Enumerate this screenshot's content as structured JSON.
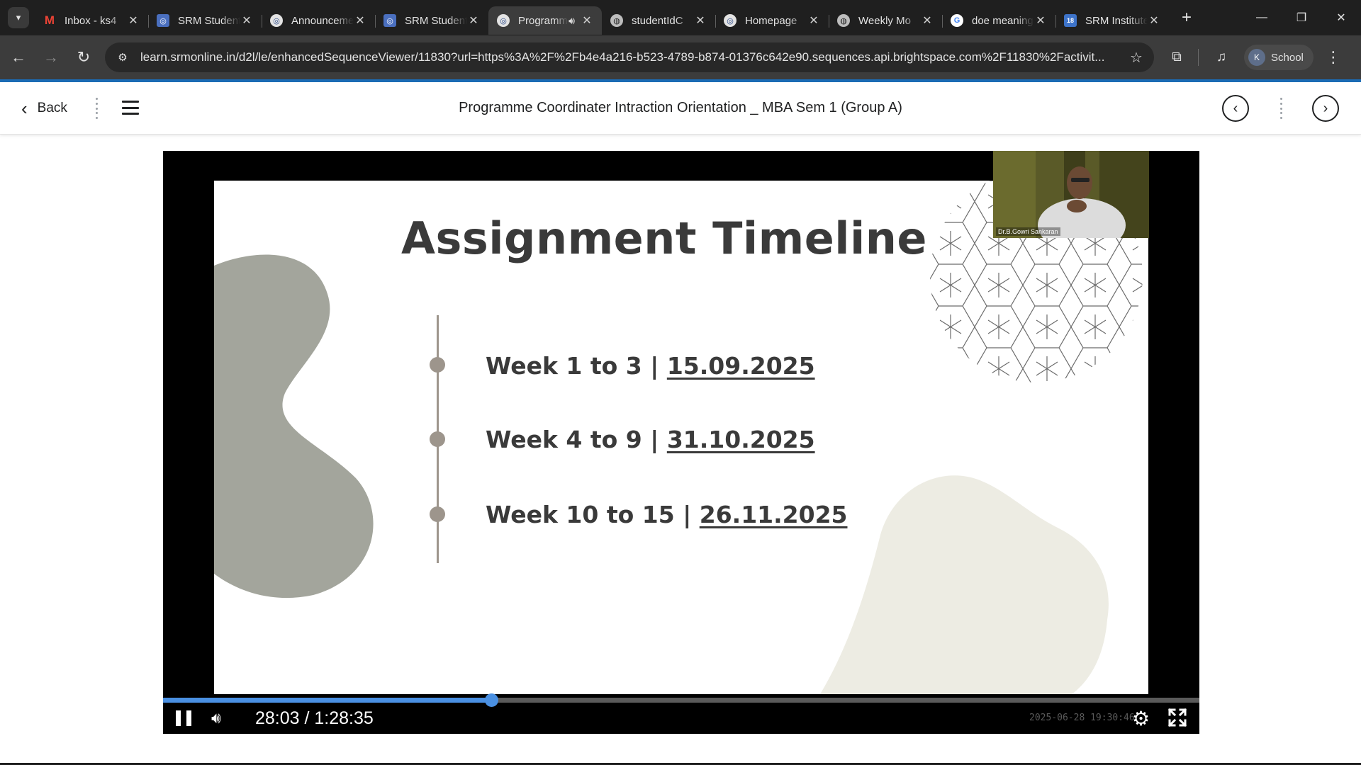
{
  "browser": {
    "tabs": [
      {
        "title": "Inbox - ks4",
        "favicon": "gmail-icon",
        "active": false
      },
      {
        "title": "SRM Student",
        "favicon": "d2l-icon",
        "active": false
      },
      {
        "title": "Announcements",
        "favicon": "d2l-circle-icon",
        "active": false
      },
      {
        "title": "SRM Student",
        "favicon": "d2l-icon",
        "active": false
      },
      {
        "title": "Programme",
        "favicon": "d2l-circle-icon",
        "active": true,
        "audio": true
      },
      {
        "title": "studentIdC",
        "favicon": "globe-icon",
        "active": false
      },
      {
        "title": "Homepage",
        "favicon": "d2l-circle-icon",
        "active": false
      },
      {
        "title": "Weekly Mo",
        "favicon": "globe-icon",
        "active": false
      },
      {
        "title": "doe meaning",
        "favicon": "google-icon",
        "active": false
      },
      {
        "title": "SRM Institute",
        "favicon": "srm-icon",
        "active": false
      }
    ],
    "url": "learn.srmonline.in/d2l/le/enhancedSequenceViewer/11830?url=https%3A%2F%2Fb4e4a216-b523-4789-b874-01376c642e90.sequences.api.brightspace.com%2F11830%2Factivit...",
    "profile_label": "School",
    "profile_initial": "K"
  },
  "header": {
    "back_label": "Back",
    "title": "Programme Coordinater Intraction Orientation _ MBA Sem 1 (Group A)"
  },
  "slide": {
    "title": "Assignment Timeline",
    "timeline": [
      {
        "weeks": "Week 1 to 3",
        "separator": " | ",
        "date": "15.09.2025"
      },
      {
        "weeks": "Week 4 to 9",
        "separator": " | ",
        "date": "31.10.2025"
      },
      {
        "weeks": "Week 10 to 15",
        "separator": " | ",
        "date": "26.11.2025"
      }
    ]
  },
  "video": {
    "presenter_label": "Dr.B.Gowri Sankaran",
    "current_time": "28:03",
    "duration": "1:28:35",
    "time_display": "28:03 / 1:28:35",
    "progress": 0.317,
    "watermark": "2025-06-28 19:30:46"
  },
  "colors": {
    "accent": "#1b6cb5",
    "progress": "#4a90e2",
    "slide_text": "#3a3a3a",
    "timeline": "#9d958c",
    "blob_left": "#a3a59c",
    "blob_right": "#edece3"
  }
}
